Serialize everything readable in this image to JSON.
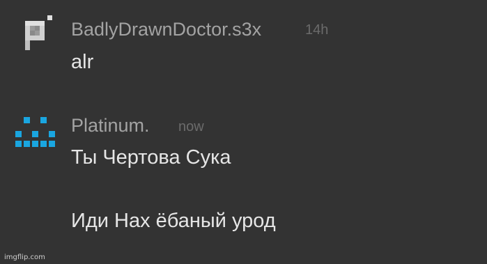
{
  "messages": [
    {
      "username": "BadlyDrawnDoctor.s3x",
      "timestamp": "14h",
      "lines": [
        "alr"
      ],
      "avatar_icon": "gray-pixel-p-icon",
      "avatar_color": "#d9d9d9",
      "username_color": "#a3a3a3"
    },
    {
      "username": "Platinum.",
      "timestamp": "now",
      "lines": [
        "Ты Чертова Сука",
        "Иди Нах ёбаный урод"
      ],
      "avatar_icon": "blue-pixel-smiley-icon",
      "avatar_color": "#1aa6e0",
      "username_color": "#a3a3a3"
    }
  ],
  "watermark": "imgflip.com",
  "colors": {
    "background": "#333333",
    "message_text": "#e6e6e6",
    "timestamp": "#6b6b6b"
  }
}
